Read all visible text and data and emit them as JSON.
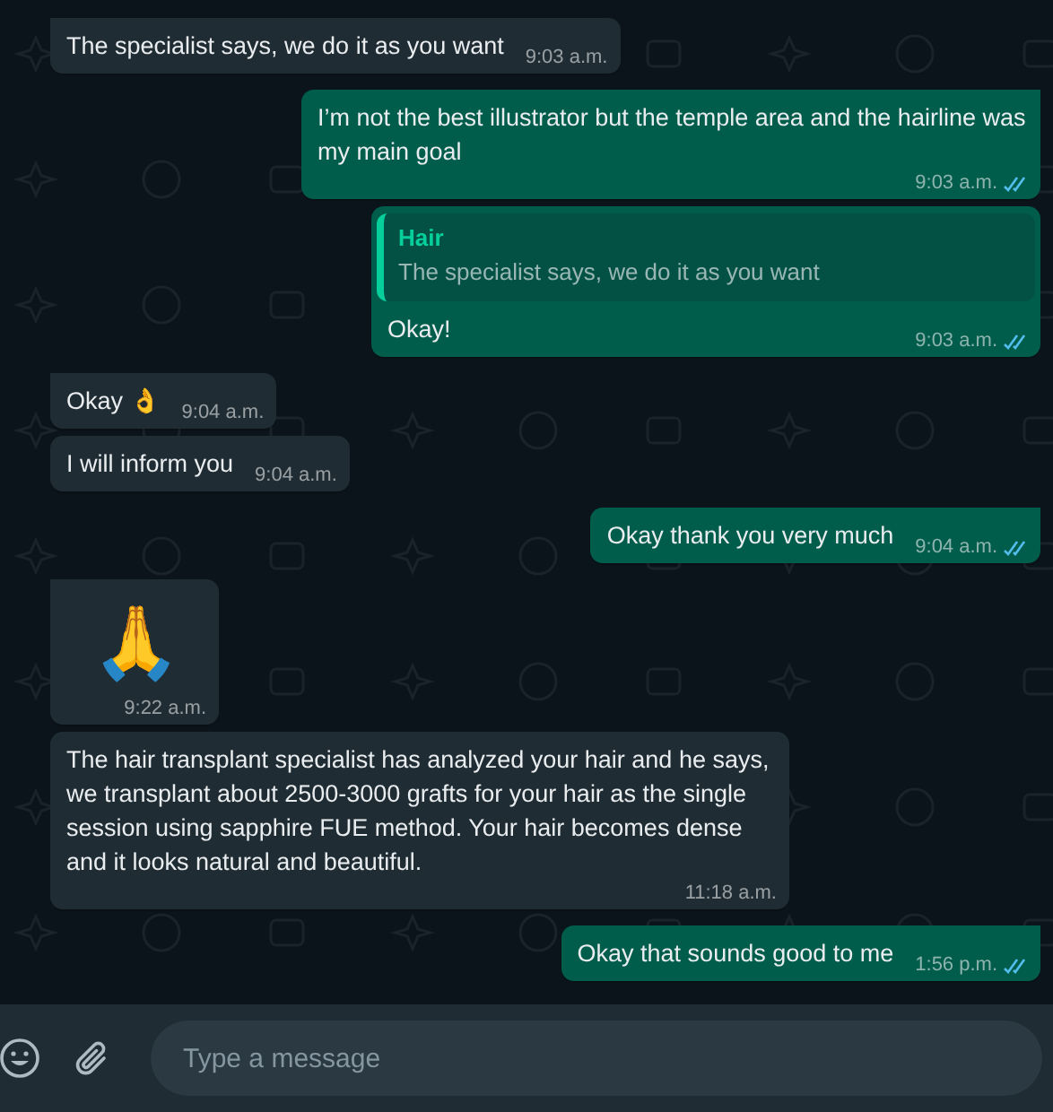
{
  "messages": [
    {
      "outgoing": false,
      "kind": "text",
      "tail": true,
      "text": "The specialist says, we do it as you want",
      "time": "9:03 a.m."
    },
    {
      "outgoing": true,
      "kind": "text",
      "tail": true,
      "text": "I’m not the best illustrator but the temple area and the hairline was my main goal",
      "time": "9:03 a.m.",
      "read": true
    },
    {
      "outgoing": true,
      "kind": "reply",
      "tail": false,
      "quote": {
        "author": "Hair",
        "text": "The specialist says, we do it as you want"
      },
      "text": "Okay!",
      "time": "9:03 a.m.",
      "read": true
    },
    {
      "outgoing": false,
      "kind": "text",
      "tail": true,
      "text": "Okay 👌",
      "time": "9:04 a.m."
    },
    {
      "outgoing": false,
      "kind": "text",
      "tail": false,
      "text": "I will inform you",
      "time": "9:04 a.m."
    },
    {
      "outgoing": true,
      "kind": "text",
      "tail": true,
      "text": "Okay thank you very much",
      "time": "9:04 a.m.",
      "read": true
    },
    {
      "outgoing": false,
      "kind": "emoji",
      "tail": true,
      "text": "🙏",
      "time": "9:22 a.m."
    },
    {
      "outgoing": false,
      "kind": "text",
      "tail": false,
      "text": "The hair transplant specialist has analyzed your hair and he says, we transplant about 2500-3000 grafts for your hair as the single session using sapphire FUE method. Your hair becomes dense and it looks natural and beautiful.",
      "time": "11:18 a.m."
    },
    {
      "outgoing": true,
      "kind": "text",
      "tail": true,
      "text": "Okay that sounds good to me",
      "time": "1:56 p.m.",
      "read": true
    }
  ],
  "composer": {
    "placeholder": "Type a message"
  }
}
